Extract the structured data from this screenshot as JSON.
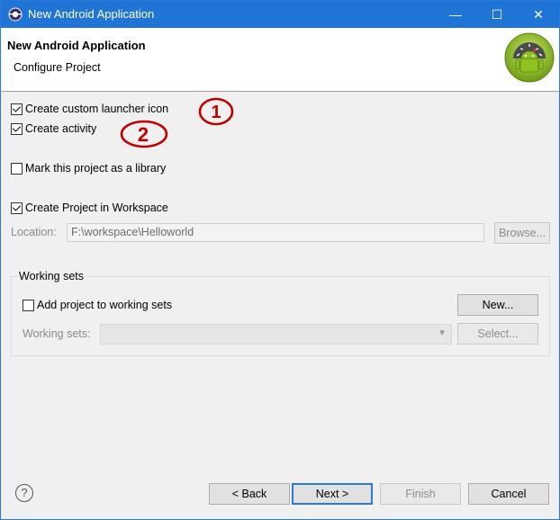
{
  "window": {
    "title": "New Android Application",
    "controls": {
      "minimize": "—",
      "maximize": "☐",
      "close": "✕"
    }
  },
  "banner": {
    "heading": "New Android Application",
    "subheading": "Configure Project",
    "logo_icon": "android-logo-icon"
  },
  "options": {
    "custom_launcher_icon": {
      "label": "Create custom launcher icon",
      "checked": true
    },
    "create_activity": {
      "label": "Create activity",
      "checked": true
    },
    "mark_library": {
      "label": "Mark this project as a library",
      "checked": false
    },
    "create_in_workspace": {
      "label": "Create Project in Workspace",
      "checked": true
    }
  },
  "location": {
    "label": "Location:",
    "value": "F:\\workspace\\Helloworld",
    "browse_label": "Browse..."
  },
  "working_sets": {
    "group_title": "Working sets",
    "add_label": "Add project to working sets",
    "add_checked": false,
    "new_label": "New...",
    "sets_label": "Working sets:",
    "select_label": "Select..."
  },
  "annotations": {
    "one": "1",
    "two": "2",
    "color": "#c00000"
  },
  "footer": {
    "help_icon": "question-icon",
    "back_label": "< Back",
    "next_label": "Next >",
    "finish_label": "Finish",
    "cancel_label": "Cancel"
  }
}
